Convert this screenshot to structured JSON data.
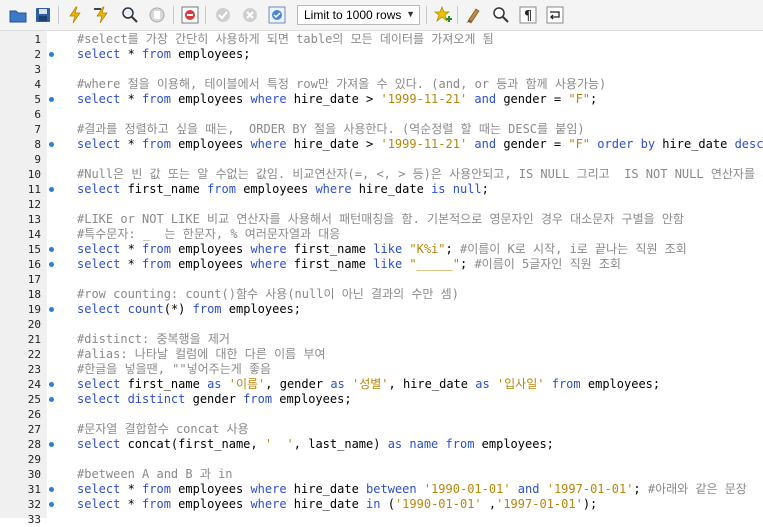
{
  "toolbar": {
    "limit_label": "Limit to 1000 rows",
    "icons": [
      "open-folder-icon",
      "save-icon",
      "execute-icon",
      "execute-current-icon",
      "explain-icon",
      "stop-icon",
      "toggle-error-icon",
      "commit-icon",
      "rollback-icon",
      "autocommit-icon",
      "beautify-icon",
      "find-icon",
      "invisible-chars-icon",
      "wrap-icon"
    ]
  },
  "editor": {
    "lines": [
      {
        "n": "1",
        "dot": false,
        "seg": [
          [
            "cm",
            "#select를 가장 간단히 사용하게 되면 table의 모든 데이터를 가져오게 됨"
          ]
        ]
      },
      {
        "n": "2",
        "dot": true,
        "seg": [
          [
            "kw",
            "select"
          ],
          [
            "id",
            " * "
          ],
          [
            "kw",
            "from"
          ],
          [
            "id",
            " employees;"
          ]
        ]
      },
      {
        "n": "3",
        "dot": false,
        "seg": []
      },
      {
        "n": "4",
        "dot": false,
        "seg": [
          [
            "cm",
            "#where 절을 이용해, 테이블에서 특정 row만 가져올 수 있다. (and, or 등과 함께 사용가능)"
          ]
        ]
      },
      {
        "n": "5",
        "dot": true,
        "seg": [
          [
            "kw",
            "select"
          ],
          [
            "id",
            " * "
          ],
          [
            "kw",
            "from"
          ],
          [
            "id",
            " employees "
          ],
          [
            "kw",
            "where"
          ],
          [
            "id",
            " hire_date > "
          ],
          [
            "st",
            "'1999-11-21'"
          ],
          [
            "id",
            " "
          ],
          [
            "kw",
            "and"
          ],
          [
            "id",
            " gender = "
          ],
          [
            "st",
            "\"F\""
          ],
          [
            "id",
            ";"
          ]
        ]
      },
      {
        "n": "6",
        "dot": false,
        "seg": []
      },
      {
        "n": "7",
        "dot": false,
        "seg": [
          [
            "cm",
            "#결과를 정렬하고 싶을 때는,  ORDER BY 절을 사용한다. (역순정렬 할 때는 DESC를 붙임)"
          ]
        ]
      },
      {
        "n": "8",
        "dot": true,
        "seg": [
          [
            "kw",
            "select"
          ],
          [
            "id",
            " * "
          ],
          [
            "kw",
            "from"
          ],
          [
            "id",
            " employees "
          ],
          [
            "kw",
            "where"
          ],
          [
            "id",
            " hire_date > "
          ],
          [
            "st",
            "'1999-11-21'"
          ],
          [
            "id",
            " "
          ],
          [
            "kw",
            "and"
          ],
          [
            "id",
            " gender = "
          ],
          [
            "st",
            "\"F\""
          ],
          [
            "id",
            " "
          ],
          [
            "kw",
            "order by"
          ],
          [
            "id",
            " hire_date "
          ],
          [
            "kw",
            "desc"
          ],
          [
            "id",
            ";"
          ]
        ]
      },
      {
        "n": "9",
        "dot": false,
        "seg": []
      },
      {
        "n": "10",
        "dot": false,
        "seg": [
          [
            "cm",
            "#Null은 빈 값 또는 알 수없는 값임. 비교연산자(=, <, > 등)은 사용안되고, IS NULL 그리고  IS NOT NULL 연산자를 사용."
          ]
        ]
      },
      {
        "n": "11",
        "dot": true,
        "seg": [
          [
            "kw",
            "select"
          ],
          [
            "id",
            " first_name "
          ],
          [
            "kw",
            "from"
          ],
          [
            "id",
            " employees "
          ],
          [
            "kw",
            "where"
          ],
          [
            "id",
            " hire_date "
          ],
          [
            "kw",
            "is null"
          ],
          [
            "id",
            ";"
          ]
        ]
      },
      {
        "n": "12",
        "dot": false,
        "seg": []
      },
      {
        "n": "13",
        "dot": false,
        "seg": [
          [
            "cm",
            "#LIKE or NOT LIKE 비교 연산자를 사용해서 패턴매칭을 함. 기본적으로 영문자인 경우 대소문자 구별을 안함"
          ]
        ]
      },
      {
        "n": "14",
        "dot": false,
        "seg": [
          [
            "cm",
            "#특수문자: _  는 한문자, % 여러문자열과 대응"
          ]
        ]
      },
      {
        "n": "15",
        "dot": true,
        "seg": [
          [
            "kw",
            "select"
          ],
          [
            "id",
            " * "
          ],
          [
            "kw",
            "from"
          ],
          [
            "id",
            " employees "
          ],
          [
            "kw",
            "where"
          ],
          [
            "id",
            " first_name "
          ],
          [
            "kw",
            "like"
          ],
          [
            "id",
            " "
          ],
          [
            "st",
            "\"K%i\""
          ],
          [
            "id",
            "; "
          ],
          [
            "cm",
            "#이름이 K로 시작, i로 끝나는 직원 조회"
          ]
        ]
      },
      {
        "n": "16",
        "dot": true,
        "seg": [
          [
            "kw",
            "select"
          ],
          [
            "id",
            " * "
          ],
          [
            "kw",
            "from"
          ],
          [
            "id",
            " employees "
          ],
          [
            "kw",
            "where"
          ],
          [
            "id",
            " first_name "
          ],
          [
            "kw",
            "like"
          ],
          [
            "id",
            " "
          ],
          [
            "st",
            "\"_____\""
          ],
          [
            "id",
            "; "
          ],
          [
            "cm",
            "#이름이 5글자인 직원 조회"
          ]
        ]
      },
      {
        "n": "17",
        "dot": false,
        "seg": []
      },
      {
        "n": "18",
        "dot": false,
        "seg": [
          [
            "cm",
            "#row counting: count()함수 사용(null이 아닌 결과의 수만 셈)"
          ]
        ]
      },
      {
        "n": "19",
        "dot": true,
        "seg": [
          [
            "kw",
            "select"
          ],
          [
            "id",
            " "
          ],
          [
            "kw",
            "count"
          ],
          [
            "id",
            "(*) "
          ],
          [
            "kw",
            "from"
          ],
          [
            "id",
            " employees;"
          ]
        ]
      },
      {
        "n": "20",
        "dot": false,
        "seg": []
      },
      {
        "n": "21",
        "dot": false,
        "seg": [
          [
            "cm",
            "#distinct: 중복행을 제거"
          ]
        ]
      },
      {
        "n": "22",
        "dot": false,
        "seg": [
          [
            "cm",
            "#alias: 나타날 컬럼에 대한 다른 이름 부여"
          ]
        ]
      },
      {
        "n": "23",
        "dot": false,
        "seg": [
          [
            "cm",
            "#한글을 넣을땐, \"\"넣어주는게 좋음"
          ]
        ]
      },
      {
        "n": "24",
        "dot": true,
        "seg": [
          [
            "kw",
            "select"
          ],
          [
            "id",
            " first_name "
          ],
          [
            "kw",
            "as"
          ],
          [
            "id",
            " "
          ],
          [
            "st",
            "'이름'"
          ],
          [
            "id",
            ", gender "
          ],
          [
            "kw",
            "as"
          ],
          [
            "id",
            " "
          ],
          [
            "st",
            "'성별'"
          ],
          [
            "id",
            ", hire_date "
          ],
          [
            "kw",
            "as"
          ],
          [
            "id",
            " "
          ],
          [
            "st",
            "'입사일'"
          ],
          [
            "id",
            " "
          ],
          [
            "kw",
            "from"
          ],
          [
            "id",
            " employees;"
          ]
        ]
      },
      {
        "n": "25",
        "dot": true,
        "seg": [
          [
            "kw",
            "select distinct"
          ],
          [
            "id",
            " gender "
          ],
          [
            "kw",
            "from"
          ],
          [
            "id",
            " employees;"
          ]
        ]
      },
      {
        "n": "26",
        "dot": false,
        "seg": []
      },
      {
        "n": "27",
        "dot": false,
        "seg": [
          [
            "cm",
            "#문자열 결합함수 concat 사용"
          ]
        ]
      },
      {
        "n": "28",
        "dot": true,
        "seg": [
          [
            "kw",
            "select"
          ],
          [
            "id",
            " concat(first_name, "
          ],
          [
            "st",
            "'  '"
          ],
          [
            "id",
            ", last_name) "
          ],
          [
            "kw",
            "as"
          ],
          [
            "id",
            " "
          ],
          [
            "kw",
            "name"
          ],
          [
            "id",
            " "
          ],
          [
            "kw",
            "from"
          ],
          [
            "id",
            " employees;"
          ]
        ]
      },
      {
        "n": "29",
        "dot": false,
        "seg": []
      },
      {
        "n": "30",
        "dot": false,
        "seg": [
          [
            "cm",
            "#between A and B 과 in"
          ]
        ]
      },
      {
        "n": "31",
        "dot": true,
        "seg": [
          [
            "kw",
            "select"
          ],
          [
            "id",
            " * "
          ],
          [
            "kw",
            "from"
          ],
          [
            "id",
            " employees "
          ],
          [
            "kw",
            "where"
          ],
          [
            "id",
            " hire_date "
          ],
          [
            "kw",
            "between"
          ],
          [
            "id",
            " "
          ],
          [
            "st",
            "'1990-01-01'"
          ],
          [
            "id",
            " "
          ],
          [
            "kw",
            "and"
          ],
          [
            "id",
            " "
          ],
          [
            "st",
            "'1997-01-01'"
          ],
          [
            "id",
            "; "
          ],
          [
            "cm",
            "#아래와 같은 문장"
          ]
        ]
      },
      {
        "n": "32",
        "dot": true,
        "seg": [
          [
            "kw",
            "select"
          ],
          [
            "id",
            " * "
          ],
          [
            "kw",
            "from"
          ],
          [
            "id",
            " employees "
          ],
          [
            "kw",
            "where"
          ],
          [
            "id",
            " hire_date "
          ],
          [
            "kw",
            "in"
          ],
          [
            "id",
            " ("
          ],
          [
            "st",
            "'1990-01-01'"
          ],
          [
            "id",
            " ,"
          ],
          [
            "st",
            "'1997-01-01'"
          ],
          [
            "id",
            ");"
          ]
        ]
      },
      {
        "n": "33",
        "dot": false,
        "seg": []
      }
    ]
  }
}
